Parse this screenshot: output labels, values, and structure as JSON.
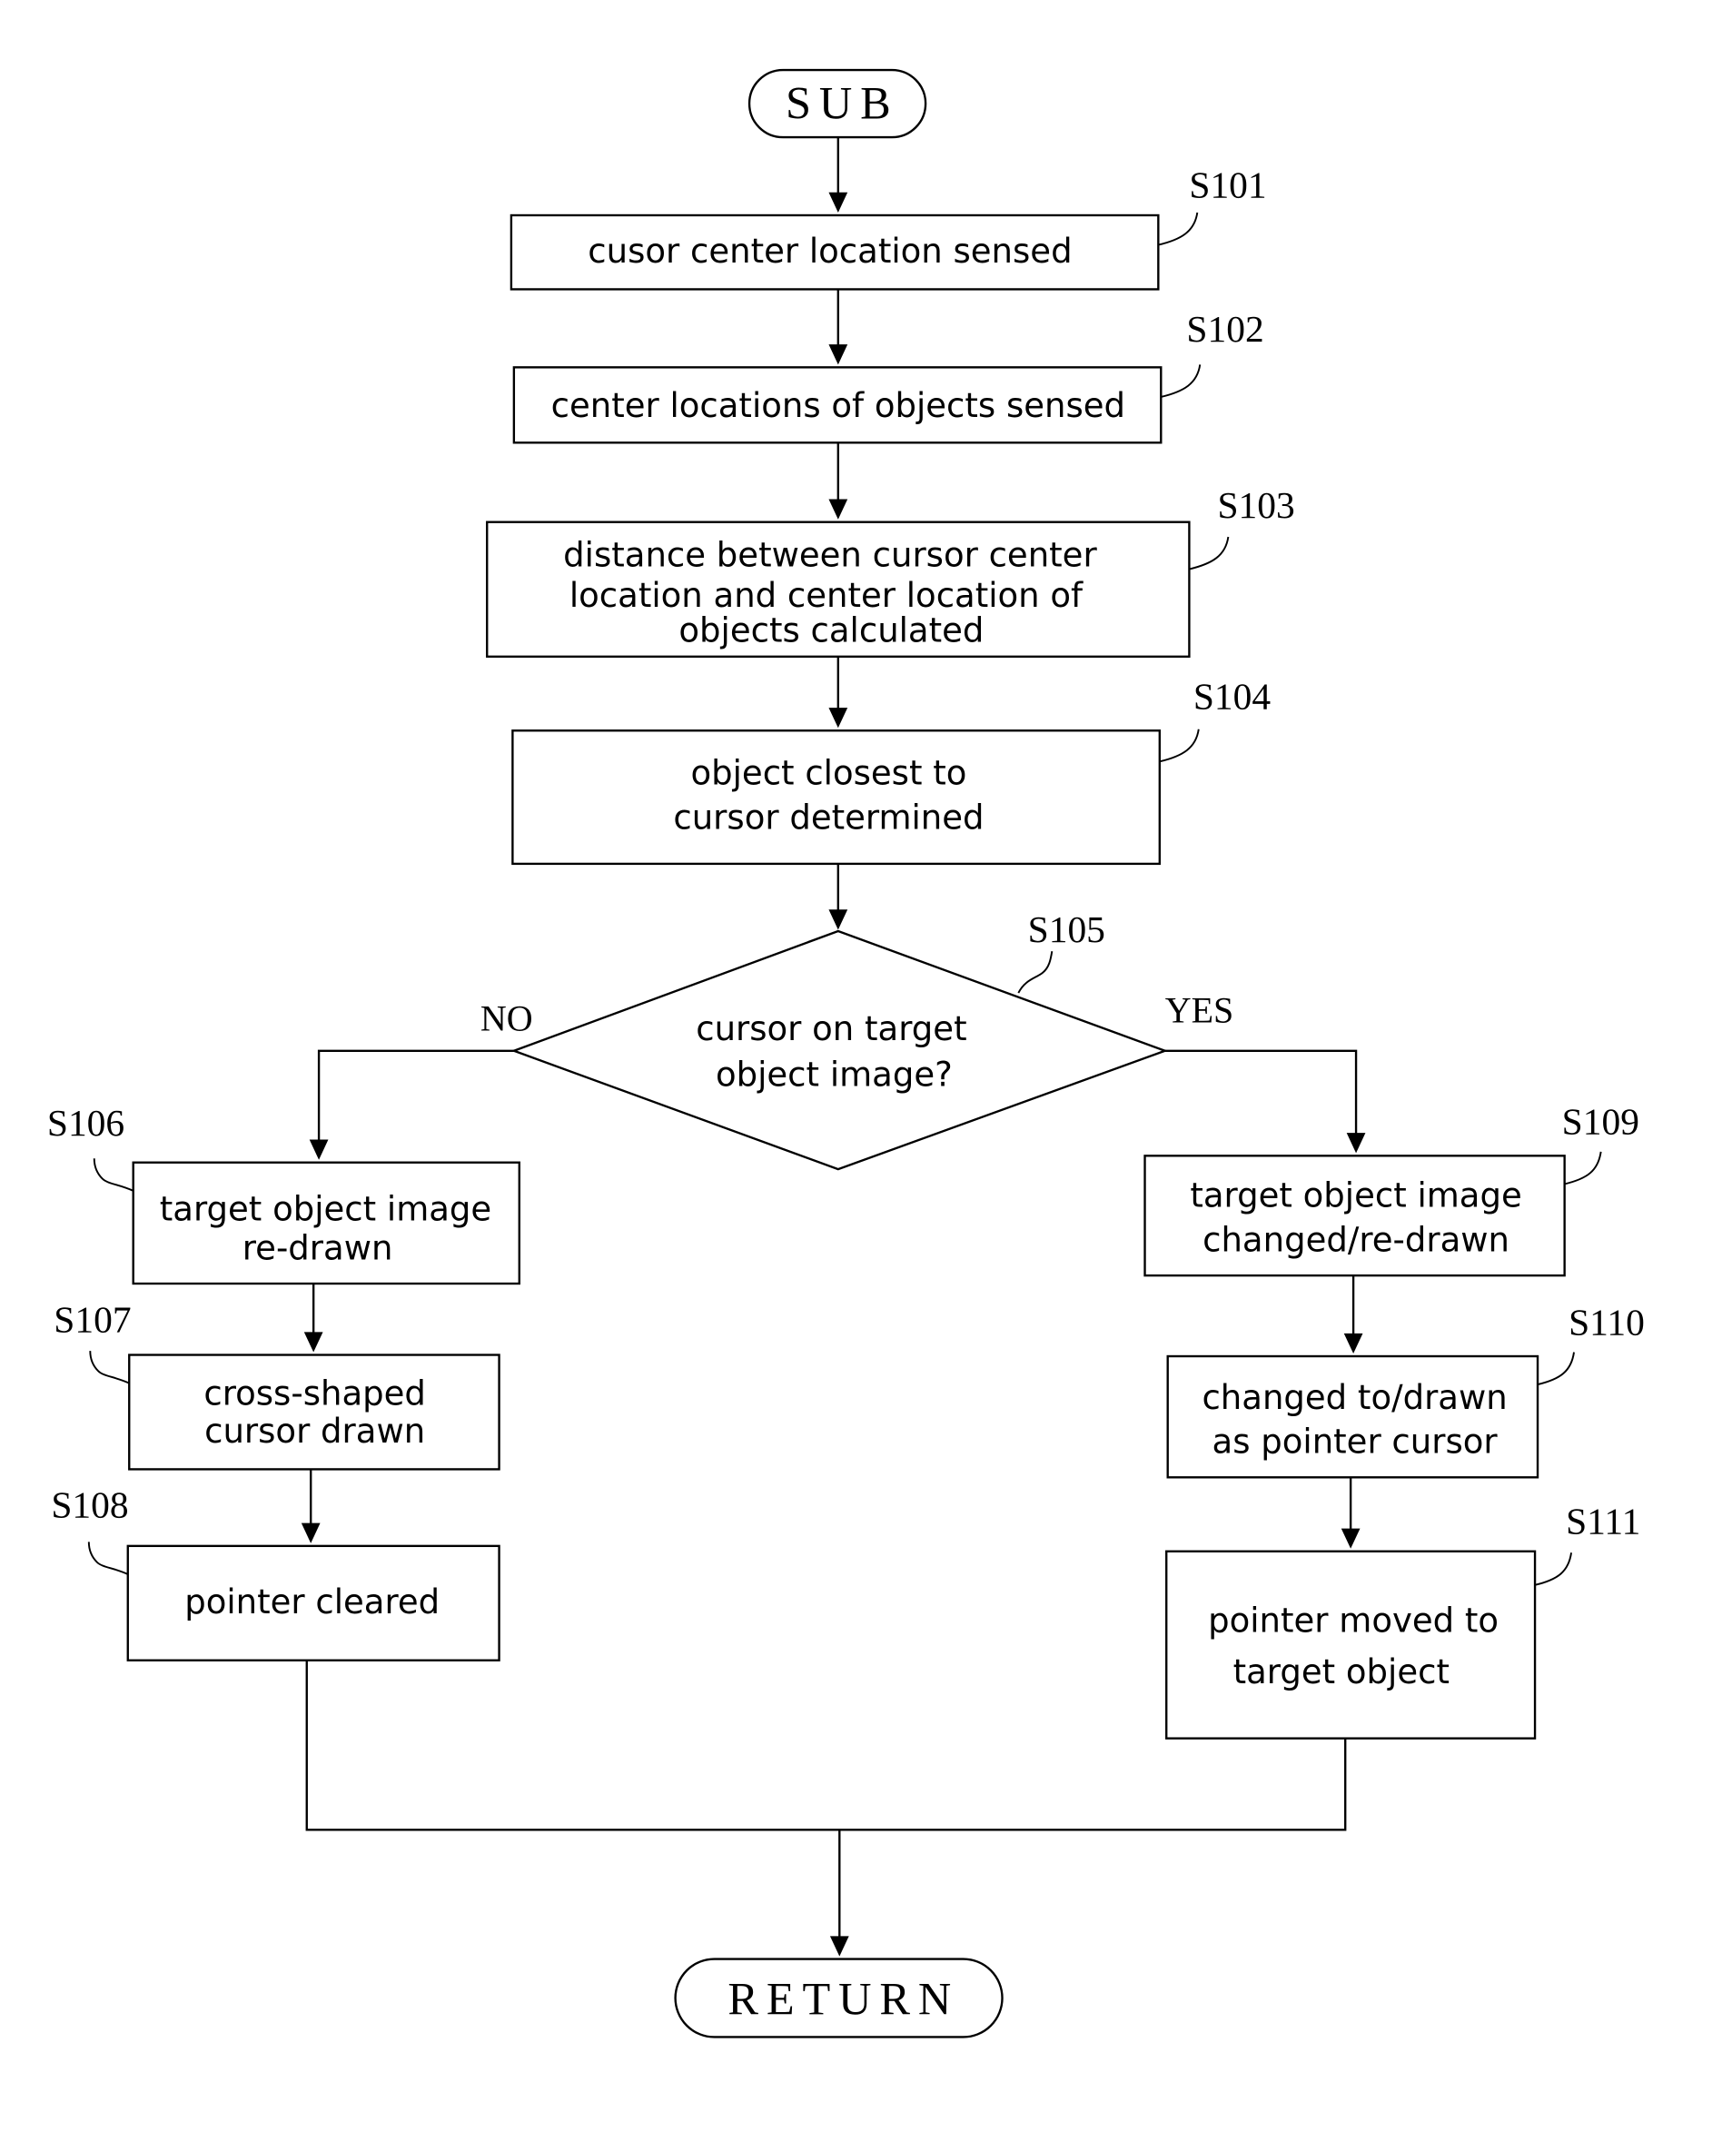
{
  "start": {
    "label": "SUB"
  },
  "end": {
    "label": "RETURN"
  },
  "steps": [
    {
      "id": "S101",
      "lines": [
        "cusor center location sensed"
      ]
    },
    {
      "id": "S102",
      "lines": [
        "center locations of objects sensed"
      ]
    },
    {
      "id": "S103",
      "lines": [
        "distance between cursor center",
        "location and center location of",
        "objects calculated"
      ]
    },
    {
      "id": "S104",
      "lines": [
        "object closest to",
        "cursor determined"
      ]
    },
    {
      "id": "S105",
      "lines": [
        "cursor on target",
        "object image?"
      ],
      "type": "decision"
    },
    {
      "id": "S106",
      "lines": [
        "target object image",
        "re-drawn"
      ]
    },
    {
      "id": "S107",
      "lines": [
        "cross-shaped",
        "cursor drawn"
      ]
    },
    {
      "id": "S108",
      "lines": [
        "pointer cleared"
      ]
    },
    {
      "id": "S109",
      "lines": [
        "target object image",
        "changed/re-drawn"
      ]
    },
    {
      "id": "S110",
      "lines": [
        "changed to/drawn",
        "as pointer cursor"
      ]
    },
    {
      "id": "S111",
      "lines": [
        "pointer moved to",
        "target object"
      ]
    }
  ],
  "branches": {
    "no": "NO",
    "yes": "YES"
  }
}
